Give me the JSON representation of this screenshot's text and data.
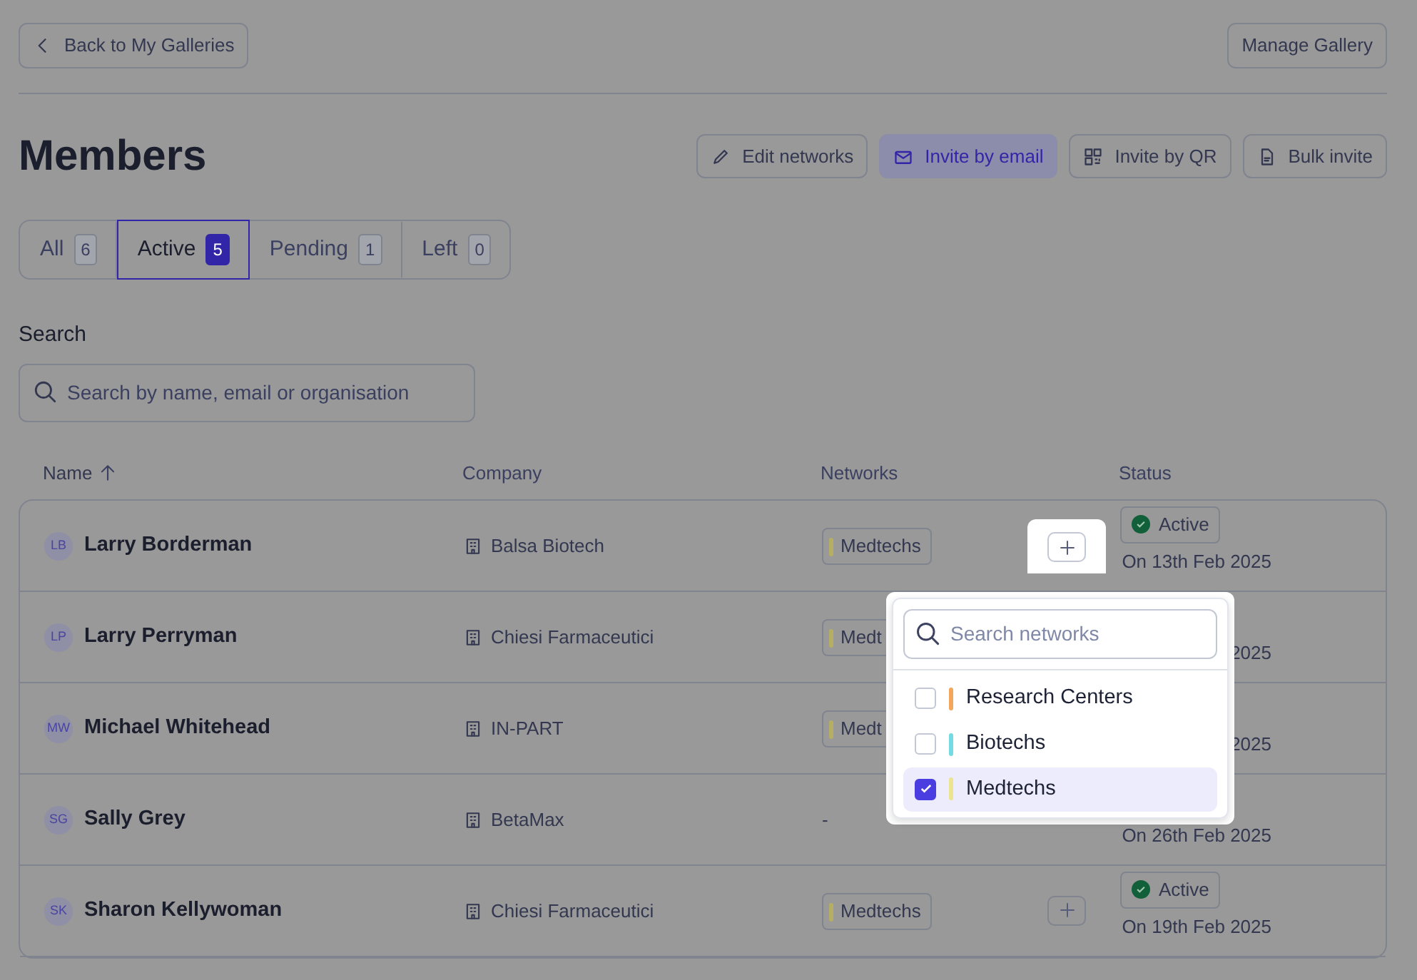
{
  "top_bar": {
    "back_button": "Back to My Galleries",
    "manage_button": "Manage Gallery"
  },
  "title": "Members",
  "actions": [
    {
      "kind": "edit",
      "label": "Edit networks",
      "primary": false
    },
    {
      "kind": "email",
      "label": "Invite by email",
      "primary": true
    },
    {
      "kind": "qr",
      "label": "Invite by QR",
      "primary": false
    },
    {
      "kind": "file",
      "label": "Bulk invite",
      "primary": false
    }
  ],
  "tabs": [
    {
      "label": "All",
      "count": "6",
      "selected": false
    },
    {
      "label": "Active",
      "count": "5",
      "selected": true
    },
    {
      "label": "Pending",
      "count": "1",
      "selected": false
    },
    {
      "label": "Left",
      "count": "0",
      "selected": false
    }
  ],
  "search": {
    "label": "Search",
    "placeholder": "Search by name, email or organisation"
  },
  "table": {
    "columns": [
      {
        "label": "Name",
        "sorted": true
      },
      {
        "label": "Company",
        "sorted": false
      },
      {
        "label": "Networks",
        "sorted": false
      },
      {
        "label": "Status",
        "sorted": false
      }
    ],
    "rows": [
      {
        "initials": "LB",
        "name": "Larry Borderman",
        "company": "Balsa Biotech",
        "networks": [
          {
            "label": "Medtechs",
            "color": "#b5ae63"
          }
        ],
        "add_button": true,
        "picker_open": true,
        "status": "Active",
        "date": "On 13th Feb 2025"
      },
      {
        "initials": "LP",
        "name": "Larry Perryman",
        "company": "Chiesi Farmaceutici",
        "networks": [
          {
            "label": "Medt",
            "color": "#b5ae63"
          }
        ],
        "add_button": false,
        "date": "2025"
      },
      {
        "initials": "MW",
        "name": "Michael Whitehead",
        "company": "IN-PART",
        "networks": [
          {
            "label": "Medt",
            "color": "#b5ae63"
          }
        ],
        "add_button": false,
        "date": "2025"
      },
      {
        "initials": "SG",
        "name": "Sally Grey",
        "company": "BetaMax",
        "no_networks": "-",
        "networks": [],
        "add_button": false,
        "date": "On 26th Feb 2025"
      },
      {
        "initials": "SK",
        "name": "Sharon Kellywoman",
        "company": "Chiesi Farmaceutici",
        "networks": [
          {
            "label": "Medtechs",
            "color": "#b5ae63"
          }
        ],
        "add_button": true,
        "picker_open": false,
        "status": "Active",
        "date": "On 19th Feb 2025"
      }
    ]
  },
  "network_picker": {
    "placeholder": "Search networks",
    "options": [
      {
        "label": "Research Centers",
        "color": "#f4a65c",
        "checked": false
      },
      {
        "label": "Biotechs",
        "color": "#76dbe0",
        "checked": false
      },
      {
        "label": "Medtechs",
        "color": "#ece48e",
        "checked": true
      }
    ]
  }
}
